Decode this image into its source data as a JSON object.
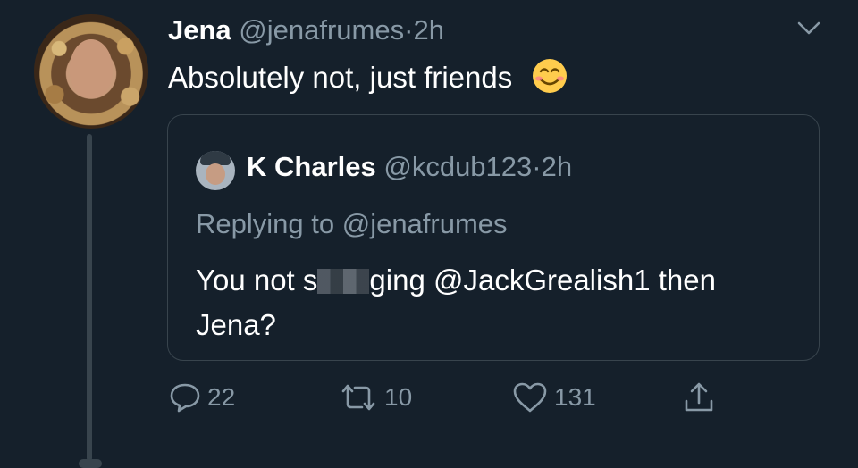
{
  "tweet": {
    "author_name": "Jena",
    "author_handle": "@jenafrumes",
    "separator": "·",
    "time": "2h",
    "text": "Absolutely not, just friends",
    "emoji": "smiling-face-emoji"
  },
  "quoted_tweet": {
    "author_name": "K Charles",
    "author_handle": "@kcdub123",
    "separator": "·",
    "time": "2h",
    "replying_label": "Replying to",
    "replying_to": "@jenafrumes",
    "text_before": "You not s",
    "text_after": "ging @JackGrealish1 then Jena?"
  },
  "actions": {
    "replies": "22",
    "retweets": "10",
    "likes": "131"
  },
  "colors": {
    "background": "#15202b",
    "secondary_text": "#8899a6",
    "border": "#38444d"
  },
  "icons": {
    "menu": "chevron-down-icon",
    "reply": "reply-bubble-icon",
    "retweet": "retweet-icon",
    "like": "heart-icon",
    "share": "share-upload-icon"
  }
}
